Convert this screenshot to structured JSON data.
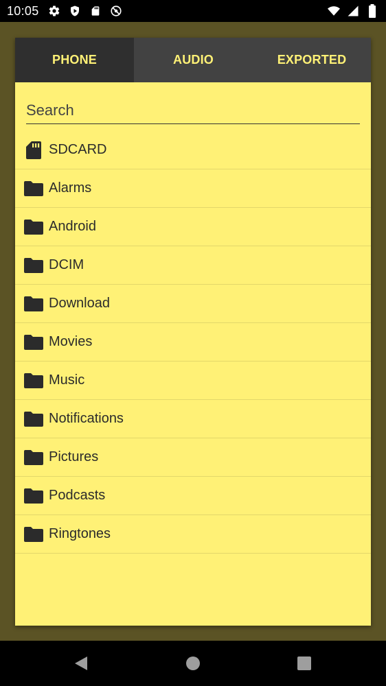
{
  "status_bar": {
    "time": "10:05",
    "left_icons": [
      "gear-icon",
      "shield-icon",
      "sdcard-icon",
      "no-sync-icon"
    ],
    "right_icons": [
      "wifi-icon",
      "signal-icon",
      "battery-icon"
    ]
  },
  "tabs": [
    {
      "label": "PHONE",
      "active": true
    },
    {
      "label": "AUDIO",
      "active": false
    },
    {
      "label": "EXPORTED",
      "active": false
    }
  ],
  "search": {
    "placeholder": "Search",
    "value": ""
  },
  "items": [
    {
      "label": "SDCARD",
      "icon": "sdcard-icon"
    },
    {
      "label": "Alarms",
      "icon": "folder-icon"
    },
    {
      "label": "Android",
      "icon": "folder-icon"
    },
    {
      "label": "DCIM",
      "icon": "folder-icon"
    },
    {
      "label": "Download",
      "icon": "folder-icon"
    },
    {
      "label": "Movies",
      "icon": "folder-icon"
    },
    {
      "label": "Music",
      "icon": "folder-icon"
    },
    {
      "label": "Notifications",
      "icon": "folder-icon"
    },
    {
      "label": "Pictures",
      "icon": "folder-icon"
    },
    {
      "label": "Podcasts",
      "icon": "folder-icon"
    },
    {
      "label": "Ringtones",
      "icon": "folder-icon"
    }
  ],
  "nav": [
    "back-icon",
    "home-icon",
    "recents-icon"
  ],
  "colors": {
    "accent": "#fff176",
    "tab_bar": "#424242",
    "backdrop": "#5b5325"
  }
}
